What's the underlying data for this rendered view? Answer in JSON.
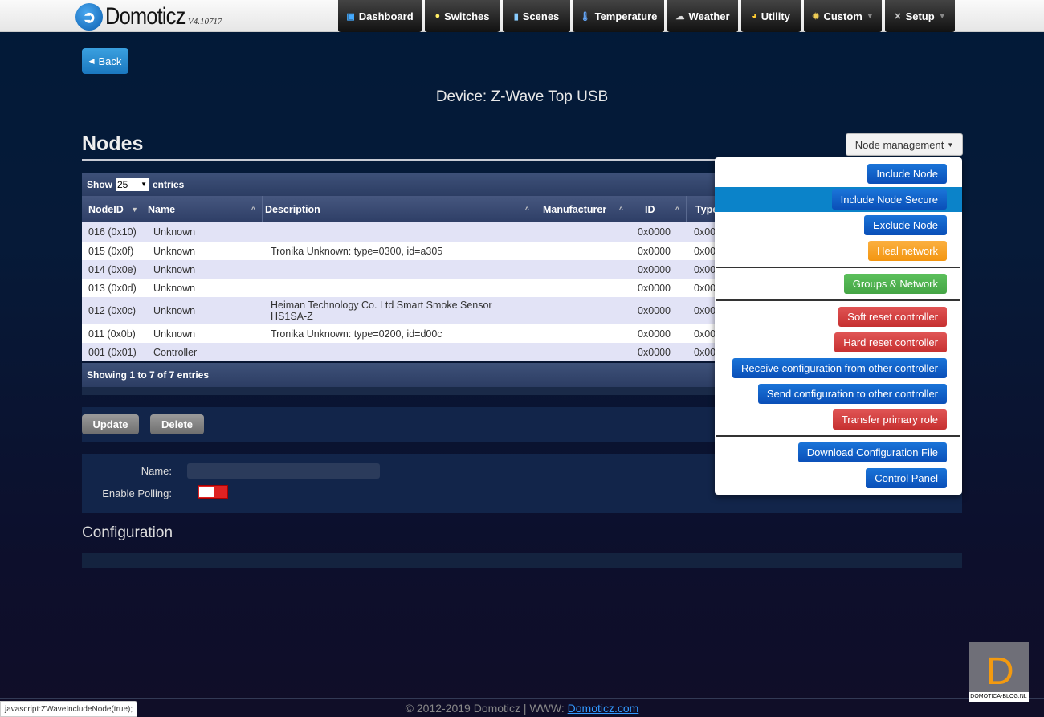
{
  "header": {
    "logo_text": "Domoticz",
    "version": "V4.10717",
    "nav": [
      {
        "label": "Dashboard",
        "icon": "dashboard-icon"
      },
      {
        "label": "Switches",
        "icon": "bulb-icon"
      },
      {
        "label": "Scenes",
        "icon": "scenes-icon"
      },
      {
        "label": "Temperature",
        "icon": "thermometer-icon"
      },
      {
        "label": "Weather",
        "icon": "weather-icon"
      },
      {
        "label": "Utility",
        "icon": "utility-icon"
      },
      {
        "label": "Custom",
        "icon": "gear-icon"
      },
      {
        "label": "Setup",
        "icon": "tools-icon"
      }
    ]
  },
  "back_label": "Back",
  "device_title": "Device: Z-Wave Top USB",
  "nodes_heading": "Nodes",
  "node_management_label": "Node management",
  "table": {
    "show": "Show",
    "entries_value": "25",
    "entries": "entries",
    "columns": [
      "NodeID",
      "Name",
      "Description",
      "Manufacturer",
      "ID",
      "Type"
    ],
    "rows": [
      [
        "016 (0x10)",
        "Unknown",
        "",
        "",
        "0x0000",
        "0x00"
      ],
      [
        "015 (0x0f)",
        "Unknown",
        "Tronika Unknown: type=0300, id=a305",
        "",
        "0x0000",
        "0x00"
      ],
      [
        "014 (0x0e)",
        "Unknown",
        "",
        "",
        "0x0000",
        "0x00"
      ],
      [
        "013 (0x0d)",
        "Unknown",
        "",
        "",
        "0x0000",
        "0x00"
      ],
      [
        "012 (0x0c)",
        "Unknown",
        "Heiman Technology Co. Ltd Smart Smoke Sensor HS1SA-Z",
        "",
        "0x0000",
        "0x00"
      ],
      [
        "011 (0x0b)",
        "Unknown",
        "Tronika Unknown: type=0200, id=d00c",
        "",
        "0x0000",
        "0x00"
      ],
      [
        "001 (0x01)",
        "Controller",
        "",
        "",
        "0x0000",
        "0x00"
      ]
    ],
    "info": "Showing 1 to 7 of 7 entries"
  },
  "buttons": {
    "update": "Update",
    "delete": "Delete"
  },
  "form": {
    "name_label": "Name:",
    "name_value": "",
    "polling_label": "Enable Polling:",
    "polling_on": false
  },
  "configuration_heading": "Configuration",
  "menu": [
    {
      "label": "Include Node",
      "color": "blue"
    },
    {
      "label": "Include Node Secure",
      "color": "blue"
    },
    {
      "label": "Exclude Node",
      "color": "blue"
    },
    {
      "label": "Heal network",
      "color": "orange"
    },
    {
      "label": "Groups & Network",
      "color": "green"
    },
    {
      "label": "Soft reset controller",
      "color": "red"
    },
    {
      "label": "Hard reset controller",
      "color": "red"
    },
    {
      "label": "Receive configuration from other controller",
      "color": "blue"
    },
    {
      "label": "Send configuration to other controller",
      "color": "blue"
    },
    {
      "label": "Transfer primary role",
      "color": "red"
    },
    {
      "label": "Download Configuration File",
      "color": "blue"
    },
    {
      "label": "Control Panel",
      "color": "blue"
    }
  ],
  "footer": {
    "copyright": "© 2012-2019 Domoticz | WWW: ",
    "link": "Domoticz.com"
  },
  "status_url": "javascript:ZWaveIncludeNode(true);",
  "watermark": {
    "letter": "D",
    "text": "DOMOTICA-BLOG.NL"
  }
}
